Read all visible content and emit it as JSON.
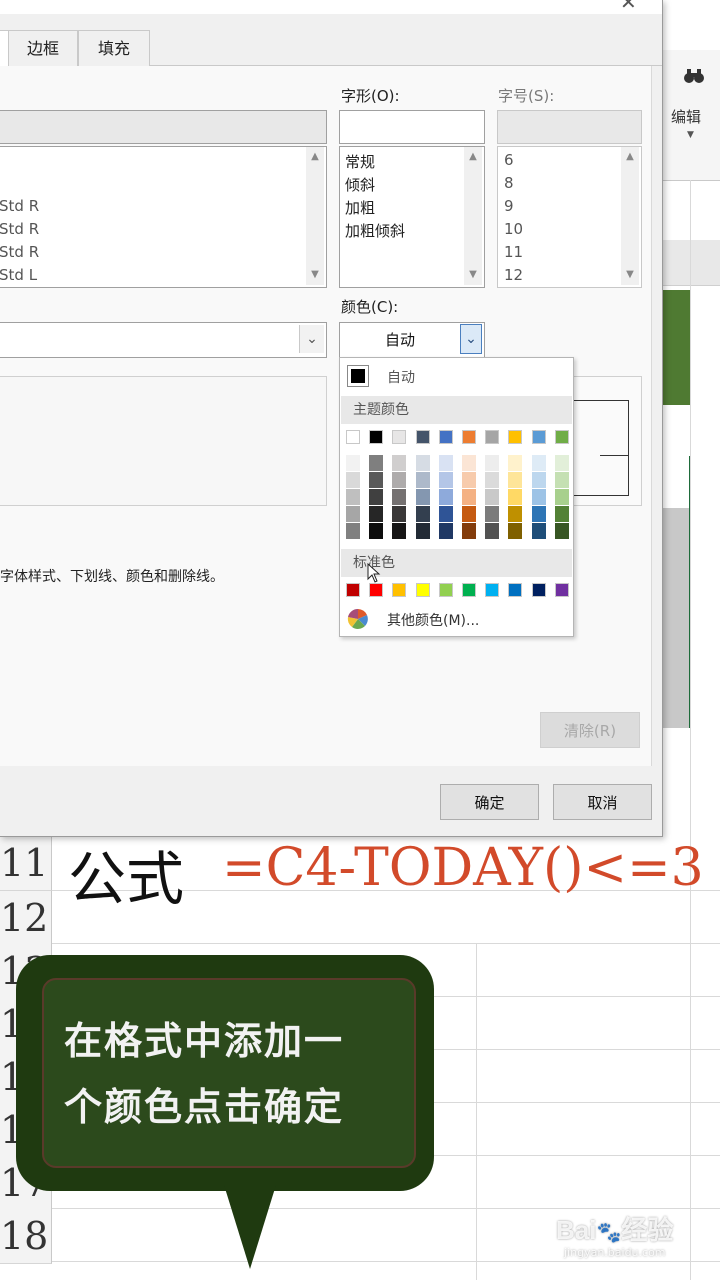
{
  "dialog": {
    "tabs": [
      {
        "label": "边框"
      },
      {
        "label": "填充"
      }
    ],
    "font_style": {
      "label": "字形(O):",
      "items": [
        "常规",
        "倾斜",
        "加粗",
        "加粗倾斜"
      ]
    },
    "font_size": {
      "label": "字号(S):",
      "items": [
        "6",
        "8",
        "9",
        "10",
        "11",
        "12"
      ]
    },
    "font_list_items": [
      "Std R",
      "Std R",
      "Std R",
      "Std L"
    ],
    "color": {
      "label": "颜色(C):",
      "value": "自动"
    },
    "hint_text": "字体样式、下划线、颜色和删除线。",
    "clear_label": "清除(R)",
    "ok_label": "确定",
    "cancel_label": "取消"
  },
  "color_popup": {
    "auto_label": "自动",
    "theme_header": "主题颜色",
    "standard_header": "标准色",
    "more_colors_label": "其他颜色(M)...",
    "theme_colors": [
      "#ffffff",
      "#000000",
      "#e7e6e6",
      "#44546a",
      "#4472c4",
      "#ed7d31",
      "#a5a5a5",
      "#ffc000",
      "#5b9bd5",
      "#70ad47"
    ],
    "theme_shades": [
      [
        "#f2f2f2",
        "#d9d9d9",
        "#bfbfbf",
        "#a6a6a6",
        "#808080"
      ],
      [
        "#7f7f7f",
        "#595959",
        "#404040",
        "#262626",
        "#0d0d0d"
      ],
      [
        "#d0cece",
        "#aeabab",
        "#757171",
        "#3a3838",
        "#171616"
      ],
      [
        "#d6dce4",
        "#adb9ca",
        "#8497b0",
        "#333f4f",
        "#222a35"
      ],
      [
        "#d9e2f3",
        "#b4c6e7",
        "#8eaadb",
        "#2f5496",
        "#1f3864"
      ],
      [
        "#fbe5d5",
        "#f7cbac",
        "#f4b183",
        "#c55a11",
        "#833c0b"
      ],
      [
        "#ededed",
        "#dbdbdb",
        "#c9c9c9",
        "#7b7b7b",
        "#525252"
      ],
      [
        "#fff2cc",
        "#fee599",
        "#ffd965",
        "#bf9000",
        "#7f6000"
      ],
      [
        "#deebf6",
        "#bdd7ee",
        "#9dc3e6",
        "#2e75b5",
        "#1e4e79"
      ],
      [
        "#e2efd9",
        "#c5e0b3",
        "#a8d08d",
        "#538135",
        "#375623"
      ]
    ],
    "standard_colors": [
      "#c00000",
      "#ff0000",
      "#ffc000",
      "#ffff00",
      "#92d050",
      "#00b050",
      "#00b0f0",
      "#0070c0",
      "#002060",
      "#7030a0"
    ]
  },
  "sheet": {
    "row_numbers": [
      "11",
      "12",
      "13",
      "14",
      "15",
      "16",
      "17",
      "18"
    ],
    "header_label": "编辑"
  },
  "overlay": {
    "formula_label": "公式",
    "formula_value": "=C4-TODAY()<=3",
    "callout_line1": "在格式中添加一",
    "callout_line2": "个颜色点击确定"
  },
  "watermark": {
    "brand": "Bai",
    "brand_cn": "经验",
    "url": "jingyan.baidu.com"
  }
}
